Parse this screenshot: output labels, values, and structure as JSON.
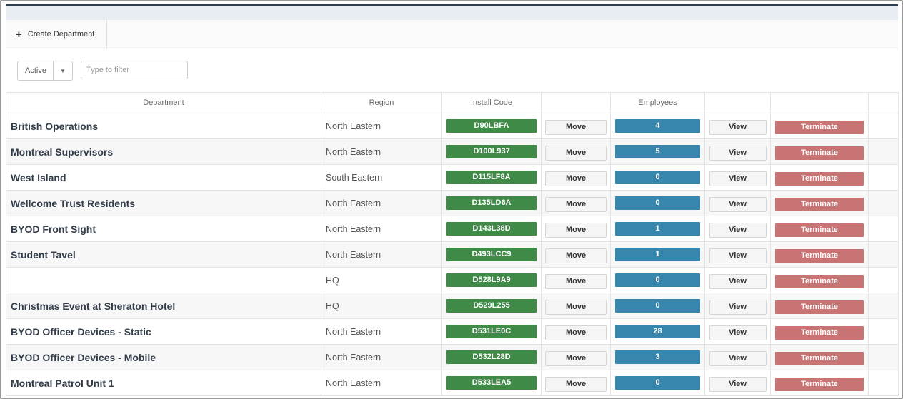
{
  "toolbar": {
    "create_label": "Create Department"
  },
  "filter": {
    "status_value": "Active",
    "placeholder": "Type to filter"
  },
  "table": {
    "headers": [
      "Department",
      "Region",
      "Install Code",
      "",
      "Employees",
      "",
      "",
      ""
    ],
    "move_label": "Move",
    "view_label": "View",
    "terminate_label": "Terminate",
    "rows": [
      {
        "department": "British Operations",
        "region": "North Eastern",
        "code": "D90LBFA",
        "employees": "4"
      },
      {
        "department": "Montreal Supervisors",
        "region": "North Eastern",
        "code": "D100L937",
        "employees": "5"
      },
      {
        "department": "West Island",
        "region": "South Eastern",
        "code": "D115LF8A",
        "employees": "0"
      },
      {
        "department": "Wellcome Trust Residents",
        "region": "North Eastern",
        "code": "D135LD6A",
        "employees": "0"
      },
      {
        "department": "BYOD Front Sight",
        "region": "North Eastern",
        "code": "D143L38D",
        "employees": "1"
      },
      {
        "department": "Student Tavel",
        "region": "North Eastern",
        "code": "D493LCC9",
        "employees": "1"
      },
      {
        "department": "",
        "region": "HQ",
        "code": "D528L9A9",
        "employees": "0"
      },
      {
        "department": "Christmas Event at Sheraton Hotel",
        "region": "HQ",
        "code": "D529L255",
        "employees": "0"
      },
      {
        "department": "BYOD Officer Devices - Static",
        "region": "North Eastern",
        "code": "D531LE0C",
        "employees": "28"
      },
      {
        "department": "BYOD Officer Devices - Mobile",
        "region": "North Eastern",
        "code": "D532L28D",
        "employees": "3"
      },
      {
        "department": "Montreal Patrol Unit 1",
        "region": "North Eastern",
        "code": "D533LEA5",
        "employees": "0"
      }
    ]
  },
  "colors": {
    "install_code": "#3f8a46",
    "employees": "#3686ad",
    "terminate": "#c87474",
    "header_bar": "#2c3e50"
  }
}
